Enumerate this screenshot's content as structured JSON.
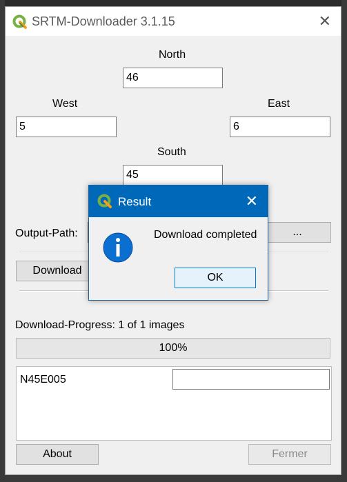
{
  "window": {
    "title": "SRTM-Downloader 3.1.15"
  },
  "coords": {
    "north_label": "North",
    "north_value": "46",
    "west_label": "West",
    "west_value": "5",
    "east_label": "East",
    "east_value": "6",
    "south_label": "South",
    "south_value": "45"
  },
  "output": {
    "label": "Output-Path:",
    "path_value": "",
    "browse_label": "..."
  },
  "actions": {
    "download_label": "Download"
  },
  "progress": {
    "label": "Download-Progress: 1 of 1 images",
    "percent_text": "100%",
    "value": 100
  },
  "files": {
    "items": [
      "N45E005"
    ],
    "field_value": ""
  },
  "footer": {
    "about_label": "About",
    "close_label": "Fermer"
  },
  "dialog": {
    "title": "Result",
    "message": "Download completed",
    "ok_label": "OK"
  },
  "colors": {
    "dialog_titlebar": "#0068b8",
    "info_icon": "#0a6fd1",
    "qgis_green": "#77b146"
  }
}
